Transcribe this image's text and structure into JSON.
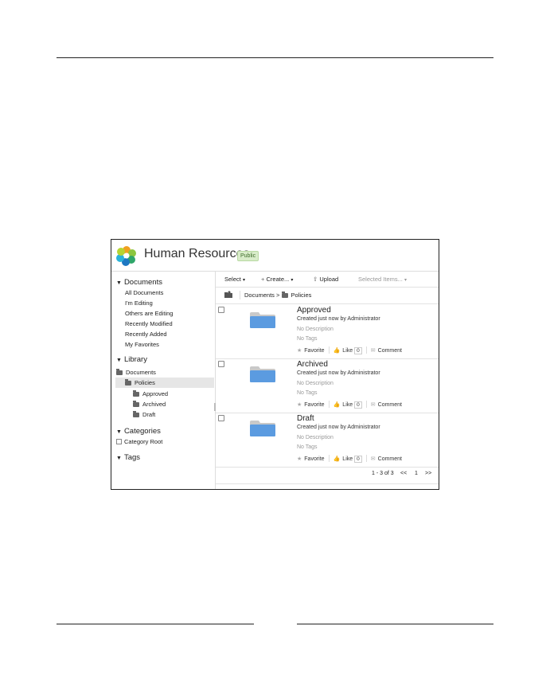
{
  "site": {
    "title": "Human Resources",
    "badge": "Public"
  },
  "sidebar": {
    "documents": {
      "heading": "Documents",
      "items": [
        "All Documents",
        "I'm Editing",
        "Others are Editing",
        "Recently Modified",
        "Recently Added",
        "My Favorites"
      ]
    },
    "library": {
      "heading": "Library",
      "root": "Documents",
      "selected": "Policies",
      "children": [
        "Approved",
        "Archived",
        "Draft"
      ]
    },
    "categories": {
      "heading": "Categories",
      "root": "Category Root"
    },
    "tags": {
      "heading": "Tags"
    }
  },
  "toolbar": {
    "select": "Select",
    "create": "Create...",
    "upload": "Upload",
    "selected_items": "Selected Items..."
  },
  "breadcrumb": {
    "root": "Documents",
    "separator": ">",
    "current": "Policies"
  },
  "rows": [
    {
      "title": "Approved",
      "created": "Created just now by Administrator",
      "description": "No Description",
      "tags": "No Tags",
      "favorite": "Favorite",
      "like": "Like",
      "likes": "0",
      "comment": "Comment"
    },
    {
      "title": "Archived",
      "created": "Created just now by Administrator",
      "description": "No Description",
      "tags": "No Tags",
      "favorite": "Favorite",
      "like": "Like",
      "likes": "0",
      "comment": "Comment"
    },
    {
      "title": "Draft",
      "created": "Created just now by Administrator",
      "description": "No Description",
      "tags": "No Tags",
      "favorite": "Favorite",
      "like": "Like",
      "likes": "0",
      "comment": "Comment"
    }
  ],
  "pager": {
    "range": "1 - 3 of 3",
    "prev": "<<",
    "page": "1",
    "next": ">>"
  },
  "icons": {
    "folder": "folder-icon",
    "home": "home-icon",
    "upload": "upload-icon",
    "star": "star-icon",
    "thumb": "thumbs-up-icon",
    "comment": "comment-icon"
  },
  "colors": {
    "folder": "#5b9be0",
    "badge_bg": "#d8ecc9"
  }
}
